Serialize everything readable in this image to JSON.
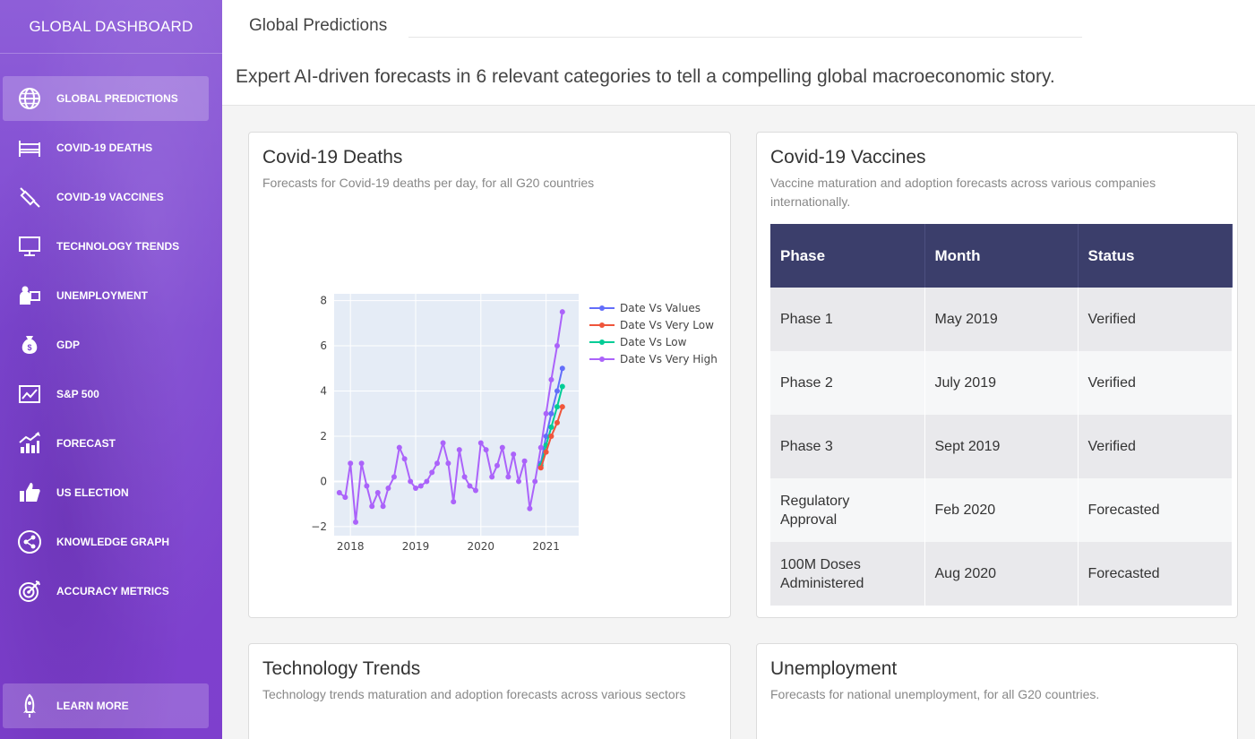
{
  "sidebar": {
    "brand": "GLOBAL DASHBOARD",
    "items": [
      {
        "label": "GLOBAL PREDICTIONS",
        "icon": "globe-icon",
        "active": true
      },
      {
        "label": "COVID-19 DEATHS",
        "icon": "hospital-bed-icon"
      },
      {
        "label": "COVID-19 VACCINES",
        "icon": "syringe-icon"
      },
      {
        "label": "TECHNOLOGY TRENDS",
        "icon": "monitor-icon"
      },
      {
        "label": "UNEMPLOYMENT",
        "icon": "job-seeker-icon"
      },
      {
        "label": "GDP",
        "icon": "money-bag-icon"
      },
      {
        "label": "S&P 500",
        "icon": "stock-chart-icon"
      },
      {
        "label": "FORECAST",
        "icon": "growth-chart-icon"
      },
      {
        "label": "US ELECTION",
        "icon": "thumbs-up-icon"
      },
      {
        "label": "KNOWLEDGE GRAPH",
        "icon": "share-network-icon"
      },
      {
        "label": "ACCURACY METRICS",
        "icon": "target-icon"
      }
    ],
    "learn_more": {
      "label": "LEARN MORE",
      "icon": "rocket-icon"
    }
  },
  "header": {
    "title": "Global Predictions",
    "intro": "Expert AI-driven forecasts in 6 relevant categories to tell a compelling global macroeconomic story."
  },
  "cards": {
    "deaths": {
      "title": "Covid-19 Deaths",
      "subtitle": "Forecasts for Covid-19 deaths per day, for all G20 countries"
    },
    "vaccines": {
      "title": "Covid-19 Vaccines",
      "subtitle": "Vaccine maturation and adoption forecasts across various companies internationally.",
      "table": {
        "headers": [
          "Phase",
          "Month",
          "Status"
        ],
        "rows": [
          [
            "Phase 1",
            "May 2019",
            "Verified"
          ],
          [
            "Phase 2",
            "July 2019",
            "Verified"
          ],
          [
            "Phase 3",
            "Sept 2019",
            "Verified"
          ],
          [
            "Regulatory Approval",
            "Feb 2020",
            "Forecasted"
          ],
          [
            "100M Doses Administered",
            "Aug 2020",
            "Forecasted"
          ]
        ]
      }
    },
    "tech": {
      "title": "Technology Trends",
      "subtitle": "Technology trends maturation and adoption forecasts across various sectors"
    },
    "unemployment": {
      "title": "Unemployment",
      "subtitle": "Forecasts for national unemployment, for all G20 countries."
    }
  },
  "chart_data": {
    "type": "line",
    "title": "",
    "xlabel": "",
    "ylabel": "",
    "xlim": [
      2017.75,
      2021.5
    ],
    "ylim": [
      -2.4,
      8.3
    ],
    "x_ticks": [
      "2018",
      "2019",
      "2020",
      "2021"
    ],
    "y_ticks": [
      -2,
      0,
      2,
      4,
      6,
      8
    ],
    "grid": true,
    "legend_placement": "right",
    "series": [
      {
        "name": "Date Vs Values",
        "color": "#636efa",
        "x": [
          2020.92,
          2021.0,
          2021.08,
          2021.17,
          2021.25
        ],
        "y": [
          0.8,
          2.0,
          3.0,
          4.0,
          5.0
        ]
      },
      {
        "name": "Date Vs Very Low",
        "color": "#ef553b",
        "x": [
          2020.92,
          2021.0,
          2021.08,
          2021.17,
          2021.25
        ],
        "y": [
          0.6,
          1.3,
          2.0,
          2.6,
          3.3
        ]
      },
      {
        "name": "Date Vs Low",
        "color": "#00cc96",
        "x": [
          2020.92,
          2021.0,
          2021.08,
          2021.17,
          2021.25
        ],
        "y": [
          0.7,
          1.6,
          2.4,
          3.3,
          4.2
        ]
      },
      {
        "name": "Date Vs Very High",
        "color": "#ab63fa",
        "x": [
          2017.83,
          2017.92,
          2018.0,
          2018.08,
          2018.17,
          2018.25,
          2018.33,
          2018.42,
          2018.5,
          2018.58,
          2018.67,
          2018.75,
          2018.83,
          2018.92,
          2019.0,
          2019.08,
          2019.17,
          2019.25,
          2019.33,
          2019.42,
          2019.5,
          2019.58,
          2019.67,
          2019.75,
          2019.83,
          2019.92,
          2020.0,
          2020.08,
          2020.17,
          2020.25,
          2020.33,
          2020.42,
          2020.5,
          2020.58,
          2020.67,
          2020.75,
          2020.83,
          2020.92,
          2021.0,
          2021.08,
          2021.17,
          2021.25
        ],
        "y": [
          -0.5,
          -0.7,
          0.8,
          -1.8,
          0.8,
          -0.2,
          -1.1,
          -0.5,
          -1.1,
          -0.3,
          0.2,
          1.5,
          1.0,
          0.0,
          -0.3,
          -0.2,
          0.0,
          0.4,
          0.8,
          1.7,
          0.8,
          -0.9,
          1.4,
          0.2,
          -0.2,
          -0.4,
          1.7,
          1.4,
          0.2,
          0.7,
          1.5,
          0.2,
          1.2,
          0.0,
          0.9,
          -1.2,
          0.0,
          1.5,
          3.0,
          4.5,
          6.0,
          7.5
        ]
      }
    ]
  }
}
